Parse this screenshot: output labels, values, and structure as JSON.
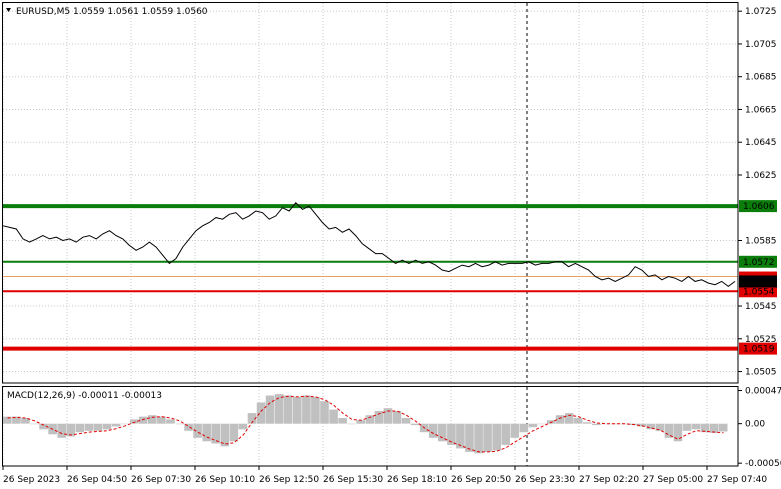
{
  "header": {
    "symbol_line": "EURUSD,M5  1.0559 1.0561 1.0559 1.0560",
    "macd_line": "MACD(12,26,9) -0.00011 -0.00013"
  },
  "colors": {
    "grid": "#c8c8c8",
    "price": "#000000",
    "green": "#0a7d0a",
    "red": "#e00000",
    "histogram": "#c0c0c0",
    "signal": "#e00000",
    "current_tag": "#000000",
    "orange_line": "#e8a060"
  },
  "chart_data": [
    {
      "type": "line",
      "title": "EURUSD,M5",
      "ylim": [
        1.0498,
        1.073
      ],
      "y_ticks": [
        "1.0725",
        "1.0705",
        "1.0685",
        "1.0665",
        "1.0645",
        "1.0625",
        "1.0585",
        "1.0545",
        "1.0525",
        "1.0505"
      ],
      "x_ticks": [
        "26 Sep 2023",
        "26 Sep 04:50",
        "26 Sep 07:30",
        "26 Sep 10:10",
        "26 Sep 12:50",
        "26 Sep 15:30",
        "26 Sep 18:10",
        "26 Sep 20:50",
        "26 Sep 23:30",
        "27 Sep 02:20",
        "27 Sep 05:00",
        "27 Sep 07:40"
      ],
      "levels": [
        {
          "value": 1.0606,
          "label": "1.0606",
          "color": "green",
          "thick": true
        },
        {
          "value": 1.0572,
          "label": "1.0572",
          "color": "green",
          "thick": false
        },
        {
          "value": 1.0554,
          "label": "1.0554",
          "color": "red",
          "thick": false
        },
        {
          "value": 1.0519,
          "label": "1.0519",
          "color": "red",
          "thick": true
        }
      ],
      "current": {
        "value": 1.056,
        "label": "1.0560"
      },
      "series": [
        {
          "values": [
            1.0594,
            1.0593,
            1.0592,
            1.0586,
            1.0584,
            1.0586,
            1.0588,
            1.0586,
            1.0587,
            1.0585,
            1.0586,
            1.0584,
            1.0587,
            1.0588,
            1.0586,
            1.0589,
            1.0591,
            1.0588,
            1.0586,
            1.0582,
            1.0579,
            1.0581,
            1.0584,
            1.0581,
            1.0576,
            1.0571,
            1.0574,
            1.0581,
            1.0586,
            1.0591,
            1.0594,
            1.0596,
            1.0599,
            1.0598,
            1.0601,
            1.0602,
            1.0598,
            1.06,
            1.0603,
            1.0602,
            1.0598,
            1.06,
            1.0605,
            1.0603,
            1.0608,
            1.0604,
            1.0606,
            1.0601,
            1.0596,
            1.0592,
            1.0593,
            1.059,
            1.0592,
            1.0588,
            1.0583,
            1.058,
            1.0577,
            1.0577,
            1.0574,
            1.0571,
            1.0573,
            1.0571,
            1.0573,
            1.0571,
            1.0572,
            1.057,
            1.0567,
            1.0566,
            1.0568,
            1.057,
            1.0569,
            1.0571,
            1.0569,
            1.057,
            1.0572,
            1.057,
            1.0571,
            1.0571,
            1.0571,
            1.0572,
            1.057,
            1.0571,
            1.0571,
            1.0572,
            1.0572,
            1.0569,
            1.0571,
            1.0569,
            1.0567,
            1.0563,
            1.0561,
            1.0562,
            1.056,
            1.0562,
            1.0564,
            1.0569,
            1.0567,
            1.0563,
            1.0564,
            1.0561,
            1.0563,
            1.0562,
            1.056,
            1.0563,
            1.056,
            1.0561,
            1.0559,
            1.0558,
            1.056,
            1.0557,
            1.056
          ]
        }
      ]
    },
    {
      "type": "bar",
      "title": "MACD(12,26,9)",
      "ylim": [
        -0.0006,
        0.00052
      ],
      "y_ticks": [
        "0.00047",
        "0.00",
        "-0.00056"
      ],
      "series": [
        {
          "name": "MACD",
          "values": [
            0.0001,
            0.0001,
            8e-05,
            0.0,
            -8e-05,
            -0.00015,
            -0.0002,
            -0.00018,
            -0.00012,
            -0.0001,
            -0.0001,
            -8e-05,
            -4e-05,
            0.0,
            6e-05,
            0.0001,
            0.00012,
            0.0001,
            6e-05,
            0.0,
            -0.0001,
            -0.0002,
            -0.00025,
            -0.00028,
            -0.00032,
            -0.00025,
            -8e-05,
            0.00015,
            0.0003,
            0.0004,
            0.00042,
            0.0004,
            0.00038,
            0.0004,
            0.00038,
            0.00032,
            0.0002,
            8e-05,
            0.0,
            5e-05,
            0.00012,
            0.00018,
            0.00022,
            0.00018,
            8e-05,
            -2e-05,
            -0.00012,
            -0.0002,
            -0.00025,
            -0.0003,
            -0.00035,
            -0.0004,
            -0.00042,
            -0.0004,
            -0.00038,
            -0.0003,
            -0.0002,
            -0.00012,
            -5e-05,
            0.0,
            5e-05,
            0.00012,
            0.00015,
            8e-05,
            2e-05,
            -2e-05,
            0.0,
            0.0,
            0.0,
            -2e-05,
            -4e-05,
            -8e-05,
            -0.0001,
            -0.0002,
            -0.00025,
            -0.0001,
            -8e-05,
            -0.00012,
            -0.00013,
            -0.00011
          ]
        },
        {
          "name": "Signal",
          "values": [
            8e-05,
            9e-05,
            8e-05,
            4e-05,
            -2e-05,
            -8e-05,
            -0.00014,
            -0.00016,
            -0.00014,
            -0.00012,
            -0.00011,
            -0.0001,
            -7e-05,
            -3e-05,
            2e-05,
            6e-05,
            9e-05,
            0.0001,
            8e-05,
            4e-05,
            -4e-05,
            -0.00012,
            -0.00019,
            -0.00024,
            -0.00029,
            -0.00027,
            -0.00016,
            2e-05,
            0.00018,
            0.0003,
            0.00037,
            0.00039,
            0.00038,
            0.00039,
            0.00038,
            0.00034,
            0.00026,
            0.00015,
            6e-05,
            5e-05,
            9e-05,
            0.00014,
            0.00018,
            0.00018,
            0.00012,
            4e-05,
            -6e-05,
            -0.00014,
            -0.0002,
            -0.00026,
            -0.00031,
            -0.00036,
            -0.0004,
            -0.0004,
            -0.00039,
            -0.00034,
            -0.00026,
            -0.00018,
            -0.0001,
            -4e-05,
            2e-05,
            8e-05,
            0.00012,
            0.0001,
            5e-05,
            1e-05,
            0.0,
            0.0,
            0.0,
            -1e-05,
            -3e-05,
            -6e-05,
            -9e-05,
            -0.00016,
            -0.00022,
            -0.00015,
            -0.0001,
            -0.00011,
            -0.00012,
            -0.00013
          ]
        }
      ]
    }
  ]
}
